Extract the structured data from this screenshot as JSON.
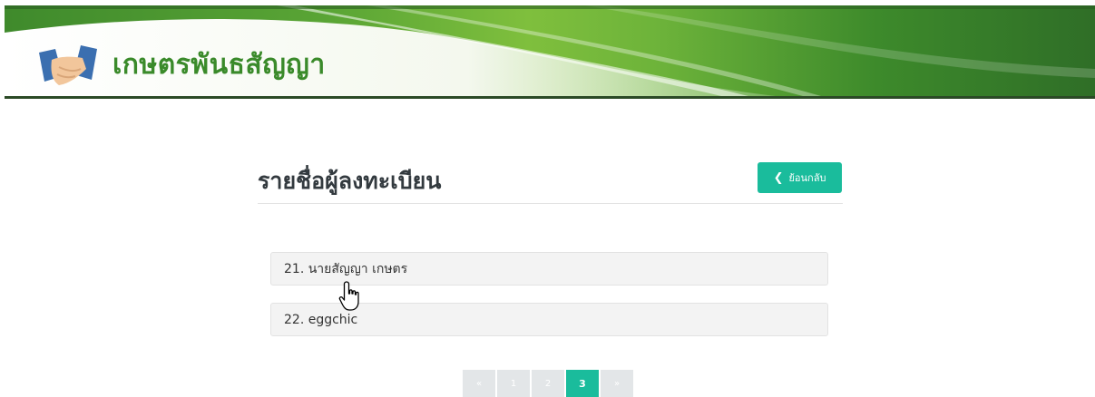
{
  "header": {
    "site_title": "เกษตรพันธสัญญา",
    "logo_icon": "handshake-icon",
    "colors": {
      "banner_dark": "#2f6e27",
      "banner_light": "#7fbf3d",
      "title_green": "#3a8a2a"
    }
  },
  "main": {
    "page_title": "รายชื่อผู้ลงทะเบียน",
    "back_button": {
      "label": "ย้อนกลับ",
      "icon": "chevron-left-icon",
      "color": "#1abc9c"
    },
    "registrants": [
      {
        "label": "21. นายสัญญา เกษตร"
      },
      {
        "label": "22. eggchic"
      }
    ]
  },
  "pagination": {
    "prev": "«",
    "pages": [
      "1",
      "2",
      "3"
    ],
    "active_page": "3",
    "next": "»"
  }
}
